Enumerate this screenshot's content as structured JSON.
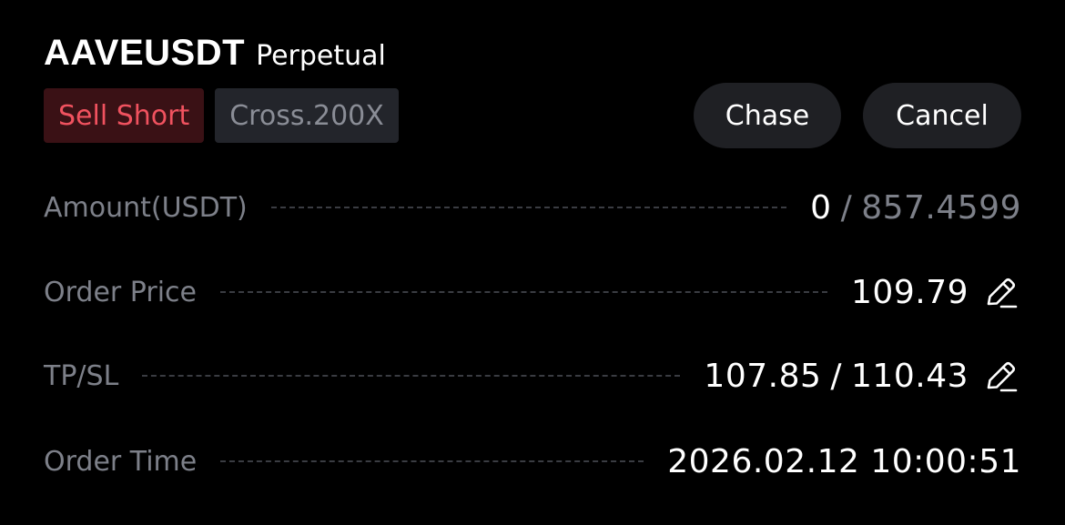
{
  "header": {
    "symbol": "AAVEUSDT",
    "contract_type": "Perpetual"
  },
  "tags": {
    "side": "Sell Short",
    "margin": "Cross.200X"
  },
  "actions": {
    "chase_label": "Chase",
    "cancel_label": "Cancel"
  },
  "details": {
    "amount": {
      "label": "Amount(USDT)",
      "filled": "0",
      "separator": "/",
      "total": "857.4599"
    },
    "order_price": {
      "label": "Order Price",
      "value": "109.79",
      "icon": "edit-pencil-icon"
    },
    "tpsl": {
      "label": "TP/SL",
      "tp": "107.85",
      "separator": "/",
      "sl": "110.43",
      "icon": "edit-pencil-icon"
    },
    "order_time": {
      "label": "Order Time",
      "value": "2026.02.12 10:00:51"
    }
  },
  "colors": {
    "background": "#000000",
    "sell_text": "#f0525f",
    "sell_bg": "#3a1115",
    "muted_text": "#7d8089",
    "button_bg": "#1f2024"
  }
}
